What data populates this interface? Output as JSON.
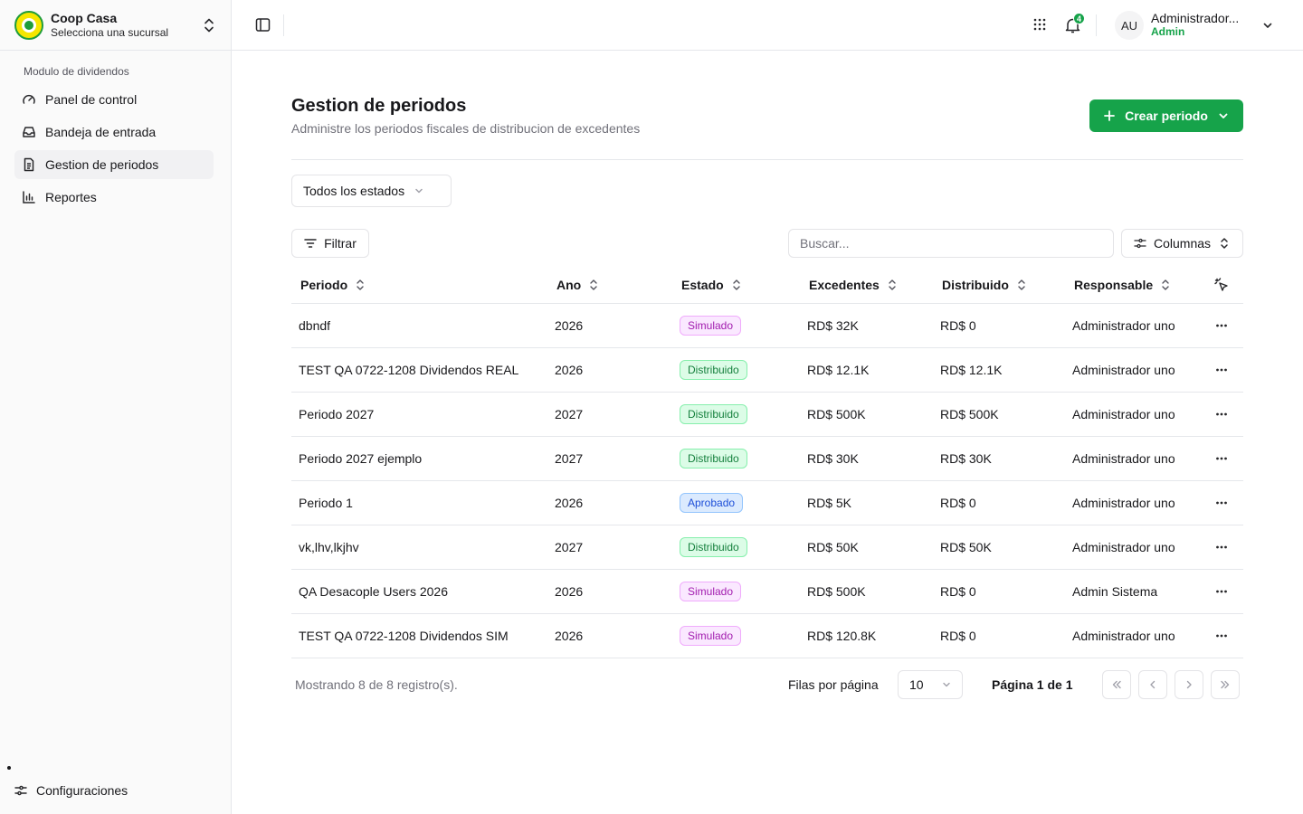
{
  "brand": {
    "name": "Coop Casa",
    "subtitle": "Selecciona una sucursal"
  },
  "sidebar": {
    "section": "Modulo de dividendos",
    "items": [
      {
        "label": "Panel de control",
        "icon": "gauge-icon"
      },
      {
        "label": "Bandeja de entrada",
        "icon": "inbox-icon"
      },
      {
        "label": "Gestion de periodos",
        "icon": "file-text-icon",
        "active": true
      },
      {
        "label": "Reportes",
        "icon": "bar-chart-icon"
      }
    ],
    "footer": "Configuraciones"
  },
  "topbar": {
    "notifications": "4",
    "avatar_initials": "AU",
    "user_name": "Administrador...",
    "user_role": "Admin"
  },
  "page": {
    "title": "Gestion de periodos",
    "subtitle": "Administre los periodos fiscales de distribucion de excedentes",
    "create_label": "Crear periodo"
  },
  "filters": {
    "status_select": "Todos los estados",
    "filter_label": "Filtrar",
    "search_placeholder": "Buscar...",
    "columns_label": "Columnas"
  },
  "table": {
    "headers": {
      "periodo": "Periodo",
      "ano": "Ano",
      "estado": "Estado",
      "excedentes": "Excedentes",
      "distribuido": "Distribuido",
      "responsable": "Responsable"
    },
    "rows": [
      {
        "periodo": "dbndf",
        "ano": "2026",
        "estado": "Simulado",
        "excedentes": "RD$ 32K",
        "distribuido": "RD$ 0",
        "responsable": "Administrador uno"
      },
      {
        "periodo": "TEST QA 0722-1208 Dividendos REAL",
        "ano": "2026",
        "estado": "Distribuido",
        "excedentes": "RD$ 12.1K",
        "distribuido": "RD$ 12.1K",
        "responsable": "Administrador uno"
      },
      {
        "periodo": "Periodo 2027",
        "ano": "2027",
        "estado": "Distribuido",
        "excedentes": "RD$ 500K",
        "distribuido": "RD$ 500K",
        "responsable": "Administrador uno"
      },
      {
        "periodo": "Periodo 2027 ejemplo",
        "ano": "2027",
        "estado": "Distribuido",
        "excedentes": "RD$ 30K",
        "distribuido": "RD$ 30K",
        "responsable": "Administrador uno"
      },
      {
        "periodo": "Periodo 1",
        "ano": "2026",
        "estado": "Aprobado",
        "excedentes": "RD$ 5K",
        "distribuido": "RD$ 0",
        "responsable": "Administrador uno"
      },
      {
        "periodo": "vk,lhv,lkjhv",
        "ano": "2027",
        "estado": "Distribuido",
        "excedentes": "RD$ 50K",
        "distribuido": "RD$ 50K",
        "responsable": "Administrador uno"
      },
      {
        "periodo": "QA Desacople Users 2026",
        "ano": "2026",
        "estado": "Simulado",
        "excedentes": "RD$ 500K",
        "distribuido": "RD$ 0",
        "responsable": "Admin Sistema"
      },
      {
        "periodo": "TEST QA 0722-1208 Dividendos SIM",
        "ano": "2026",
        "estado": "Simulado",
        "excedentes": "RD$ 120.8K",
        "distribuido": "RD$ 0",
        "responsable": "Administrador uno"
      }
    ]
  },
  "footer": {
    "count": "Mostrando 8 de 8 registro(s).",
    "rows_per_page_label": "Filas por página",
    "rows_per_page": "10",
    "page": "Página 1 de 1"
  },
  "colors": {
    "accent": "#16a34a",
    "simulado": "#a21caf",
    "distribuido": "#15803d",
    "aprobado": "#1d4ed8"
  }
}
